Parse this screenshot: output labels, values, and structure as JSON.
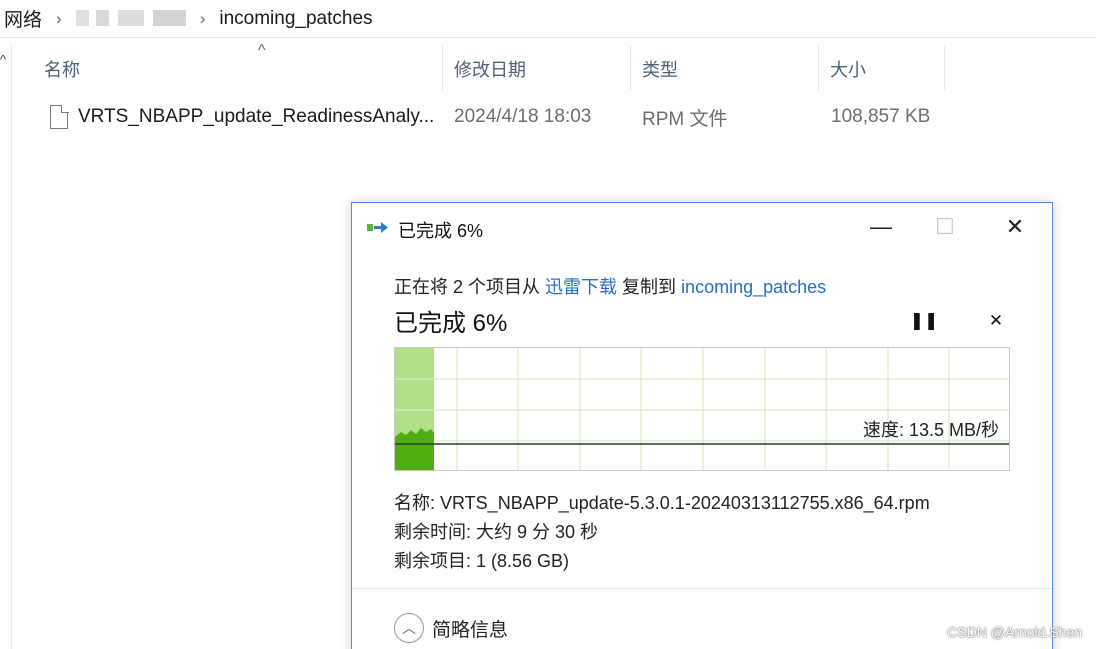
{
  "breadcrumb": {
    "root": "网络",
    "folder": "incoming_patches",
    "separator_icon": "chevron-right-icon"
  },
  "columns": {
    "name": "名称",
    "modified": "修改日期",
    "type": "类型",
    "size": "大小"
  },
  "files": [
    {
      "name": "VRTS_NBAPP_update_ReadinessAnaly...",
      "modified": "2024/4/18 18:03",
      "type": "RPM 文件",
      "size": "108,857 KB",
      "icon": "file-icon"
    }
  ],
  "dialog": {
    "title": "已完成 6%",
    "copy_prefix": "正在将 2 个项目从",
    "source": "迅雷下载",
    "copy_mid": "复制到",
    "destination": "incoming_patches",
    "progress_title": "已完成 6%",
    "progress_percent": 6,
    "speed": "速度: 13.5 MB/秒",
    "name_line": "名称: VRTS_NBAPP_update-5.3.0.1-20240313112755.x86_64.rpm",
    "remaining_time_line": "剩余时间: 大约 9 分 30 秒",
    "remaining_items_line": "剩余项目: 1 (8.56 GB)",
    "details_toggle": "简略信息",
    "colors": {
      "accent_border": "#4a8fd6",
      "link": "#2b6cc4",
      "progress_fill": "#b2e08a",
      "speed_fill": "#4fad12"
    }
  },
  "watermark": "CSDN @Arnold.Shen"
}
